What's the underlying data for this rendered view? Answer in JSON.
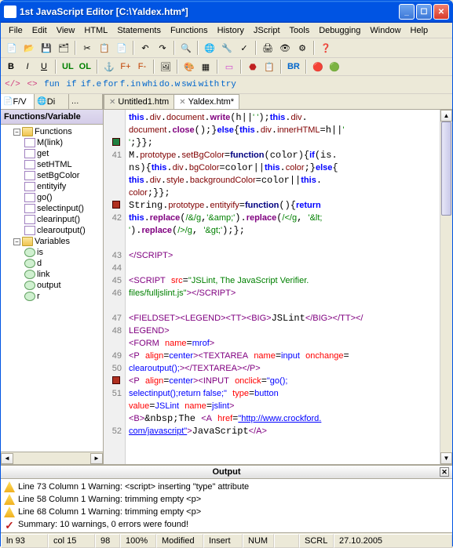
{
  "title": "1st JavaScript Editor     [C:\\Yaldex.htm*]",
  "menu": [
    "File",
    "Edit",
    "View",
    "HTML",
    "Statements",
    "Functions",
    "History",
    "JScript",
    "Tools",
    "Debugging",
    "Window",
    "Help"
  ],
  "keywords": [
    "</>",
    "<>",
    "fun",
    "if",
    "if.e",
    "for",
    "f.in",
    "whi",
    "do.w",
    "swi",
    "with",
    "try"
  ],
  "sidebar": {
    "tabs": [
      "F/V",
      "Di"
    ],
    "header": "Functions/Variable",
    "tree": {
      "fnroot": "Functions",
      "fns": [
        "M(link)",
        "get",
        "setHTML",
        "setBgColor",
        "entityify",
        "go()",
        "selectinput()",
        "clearinput()",
        "clearoutput()"
      ],
      "varroot": "Variables",
      "vars": [
        "is",
        "d",
        "link",
        "output",
        "r"
      ]
    }
  },
  "editorTabs": [
    "Untitled1.htm",
    "Yaldex.htm*"
  ],
  "gutterLines": [
    "",
    "",
    "41",
    "",
    "",
    "",
    "42",
    "",
    "",
    "43",
    "44",
    "45",
    "46",
    "",
    "47",
    "48",
    "",
    "49",
    "50",
    "",
    "51",
    "",
    "",
    "52",
    ""
  ],
  "output": {
    "title": "Output",
    "lines": [
      "Line 73 Column 1  Warning: <script> inserting \"type\" attribute",
      "Line 58 Column 1  Warning: trimming empty <p>",
      "Line 68 Column 1  Warning: trimming empty <p>"
    ],
    "summary": "Summary: 10 warnings, 0 errors were found!"
  },
  "status": {
    "ln": "ln 93",
    "col": "col 15",
    "c1": "98",
    "c2": "100%",
    "mod": "Modified",
    "ins": "Insert",
    "num": "NUM",
    "scrl": "SCRL",
    "date": "27.10.2005"
  },
  "chart_data": null
}
